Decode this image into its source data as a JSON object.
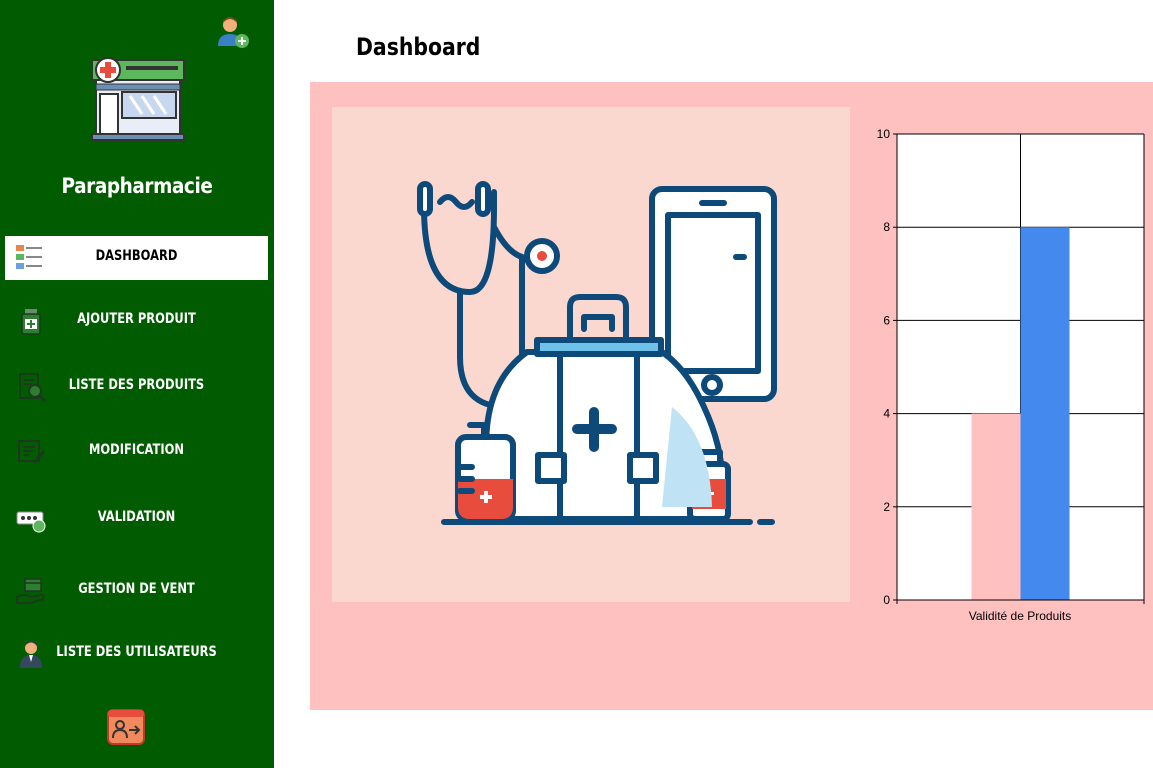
{
  "sidebar": {
    "brand": "Parapharmacie",
    "items": [
      {
        "label": "DASHBOARD",
        "active": true
      },
      {
        "label": "AJOUTER PRODUIT"
      },
      {
        "label": "LISTE DES PRODUITS"
      },
      {
        "label": "MODIFICATION"
      },
      {
        "label": "VALIDATION"
      },
      {
        "label": "GESTION DE VENT"
      },
      {
        "label": "LISTE DES UTILISATEURS"
      }
    ]
  },
  "main": {
    "title": "Dashboard"
  },
  "colors": {
    "sidebar": "#015c01",
    "panel": "#ffc0c0",
    "illustration_bg": "#fad8d0",
    "bar_pink": "#ffc0c0",
    "bar_blue": "#4389ee"
  },
  "chart_data": {
    "type": "bar",
    "categories": [
      "Validité de Produits"
    ],
    "series": [
      {
        "values": [
          4
        ]
      },
      {
        "values": [
          8
        ]
      }
    ],
    "xlabel": "Validité de Produits",
    "ylim": [
      0,
      10
    ],
    "yticks": [
      "0",
      "2",
      "4",
      "6",
      "8",
      "10"
    ],
    "grid": true
  }
}
